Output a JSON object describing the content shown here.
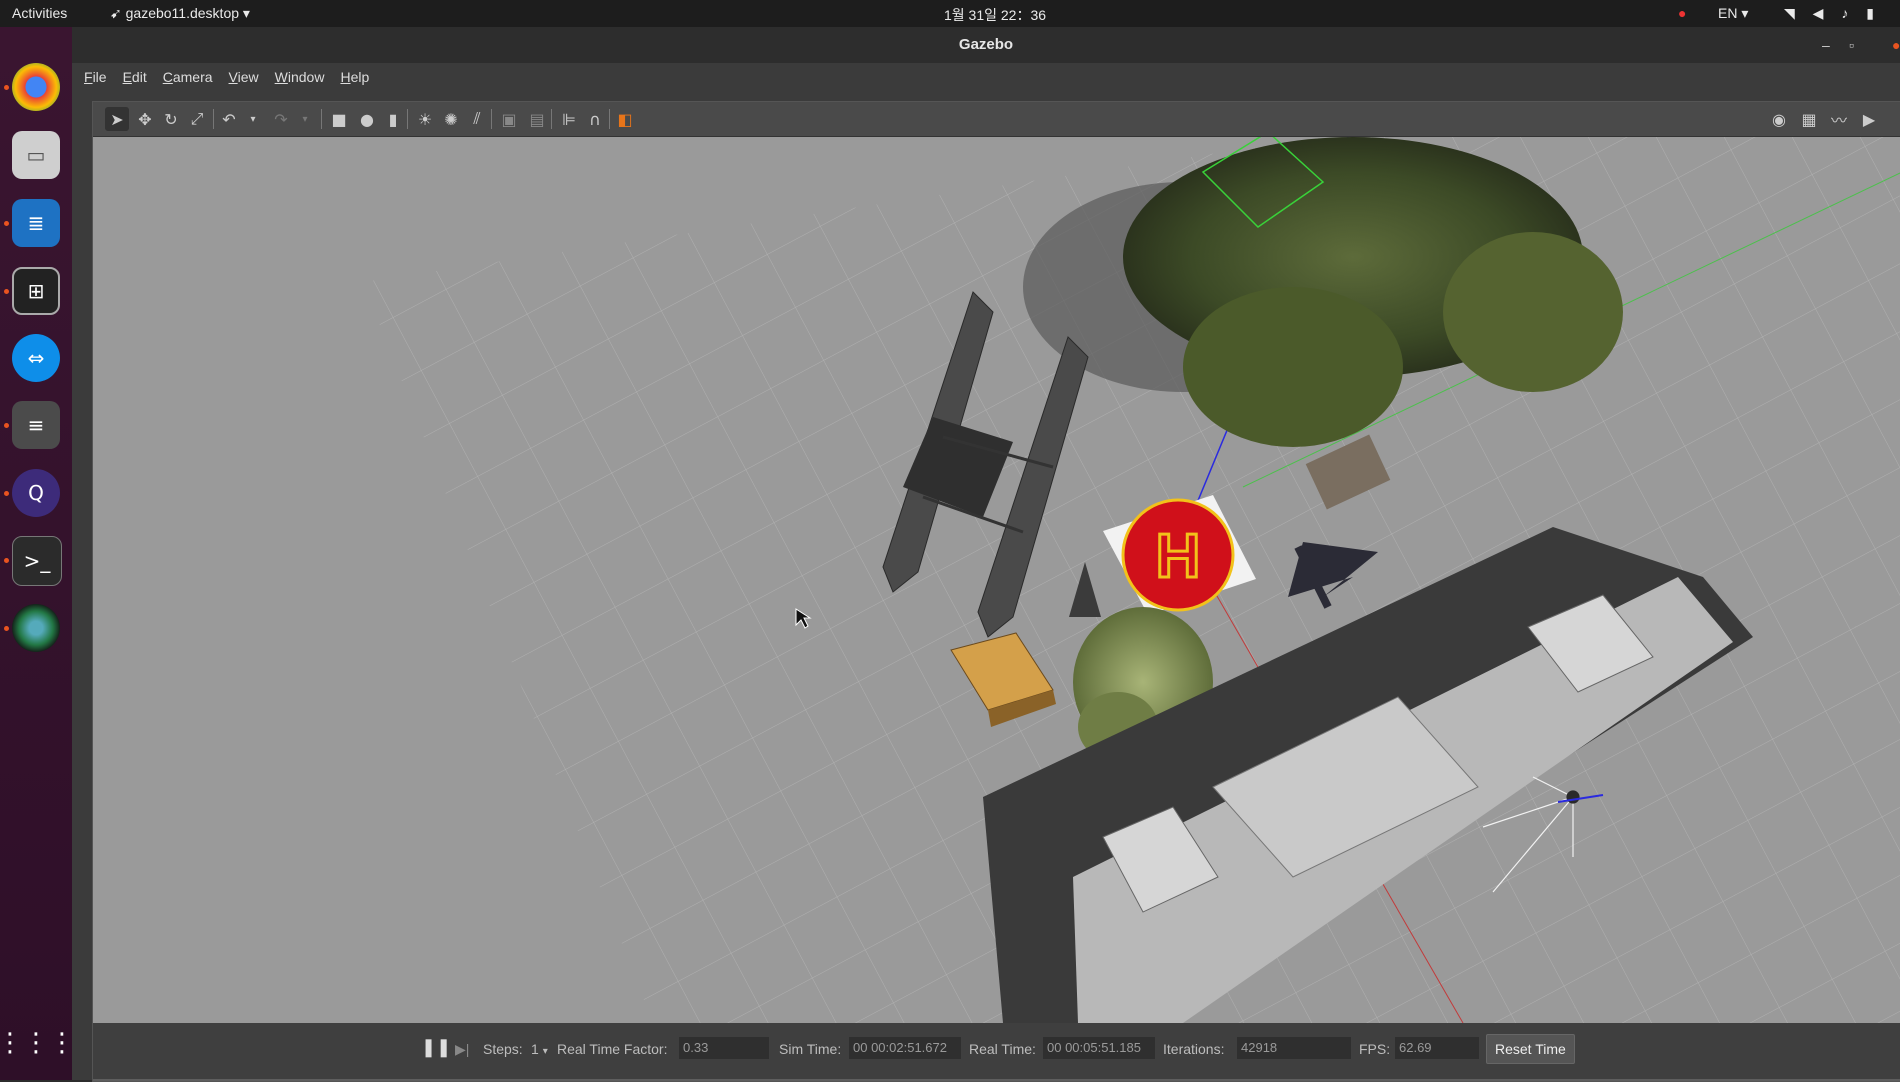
{
  "topbar": {
    "activities": "Activities",
    "app_menu": "gazebo11.desktop",
    "clock": "1월 31일 22：36",
    "language": "EN"
  },
  "window": {
    "title": "Gazebo",
    "menu": [
      "File",
      "Edit",
      "Camera",
      "View",
      "Window",
      "Help"
    ]
  },
  "dock": {
    "apps": [
      "Chrome",
      "Files",
      "Writer",
      "Terminator",
      "TeamViewer",
      "Sublime",
      "QGroundControl",
      "Terminal",
      "Camera"
    ]
  },
  "statusbar": {
    "steps_label": "Steps:",
    "steps_value": "1",
    "rtf_label": "Real Time Factor:",
    "rtf_value": "0.33",
    "sim_time_label": "Sim Time:",
    "sim_time_value": "00 00:02:51.672",
    "real_time_label": "Real Time:",
    "real_time_value": "00 00:05:51.185",
    "iterations_label": "Iterations:",
    "iterations_value": "42918",
    "fps_label": "FPS:",
    "fps_value": "62.69",
    "reset_label": "Reset Time"
  },
  "colors": {
    "ubuntu_orange": "#e95420",
    "ground": "#9a9a9a",
    "helipad_red": "#d0101a",
    "helipad_yellow": "#f2c21a"
  }
}
